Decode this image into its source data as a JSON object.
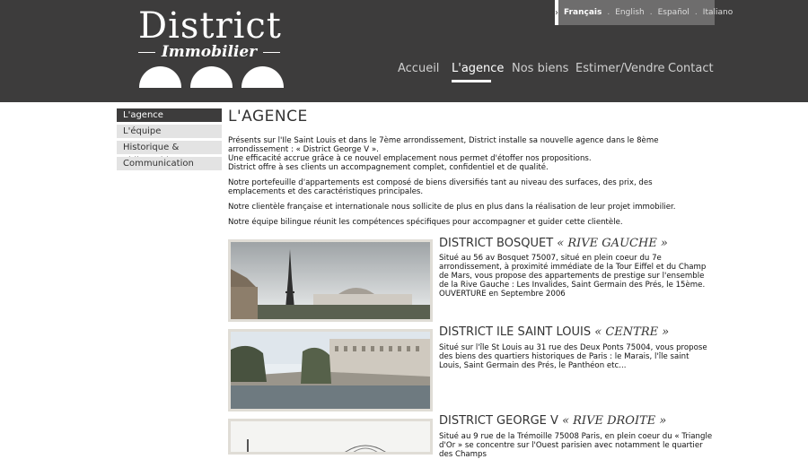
{
  "logo": {
    "main": "District",
    "sub": "Immobilier"
  },
  "languages": [
    "Français",
    "English",
    "Español",
    "Italiano"
  ],
  "nav": [
    "Accueil",
    "L'agence",
    "Nos biens",
    "Estimer/Vendre",
    "Contact"
  ],
  "sidebar": [
    "L'agence",
    "L'équipe",
    "Historique & Philosophie",
    "Communication"
  ],
  "page_title": "L'AGENCE",
  "paragraphs": [
    "Présents sur l'Ile Saint Louis et dans le 7ème arrondissement, District installe sa nouvelle agence dans le 8ème arrondissement : « District George V ».\nUne efficacité accrue grâce à ce nouvel emplacement nous permet d'étoffer nos propositions.\nDistrict offre à ses clients un accompagnement complet, confidentiel et de qualité.",
    "Notre portefeuille d'appartements est composé de biens diversifiés tant au niveau des surfaces, des prix, des emplacements et des caractéristiques principales.",
    "Notre clientèle française et internationale nous sollicite de plus en plus dans la réalisation de leur projet immobilier.",
    "Notre équipe bilingue réunit les compétences spécifiques pour accompagner et guider cette clientèle."
  ],
  "agencies": [
    {
      "name": "DISTRICT BOSQUET",
      "tag": "« RIVE GAUCHE »",
      "text": "Situé au 56 av Bosquet 75007, situé en plein coeur du 7e arrondissement, à proximité immédiate de la Tour Eiffel et du Champ de Mars, vous propose des appartements de prestige sur l'ensemble de la Rive Gauche : Les Invalides, Saint Germain des Prés, le 15ème.\nOUVERTURE en Septembre 2006"
    },
    {
      "name": "DISTRICT ILE SAINT LOUIS",
      "tag": "« CENTRE »",
      "text": "Situé sur l'île St Louis au 31 rue des Deux Ponts 75004, vous propose des biens des quartiers historiques de Paris : le Marais, l'île saint Louis, Saint Germain des Prés, le Panthéon etc..."
    },
    {
      "name": "DISTRICT GEORGE V",
      "tag": "« RIVE DROITE »",
      "text": "Situé au 9 rue de la Trémoille 75008 Paris, en plein coeur du « Triangle d'Or » se concentre sur l'Ouest parisien avec notamment le quartier des Champs"
    }
  ]
}
